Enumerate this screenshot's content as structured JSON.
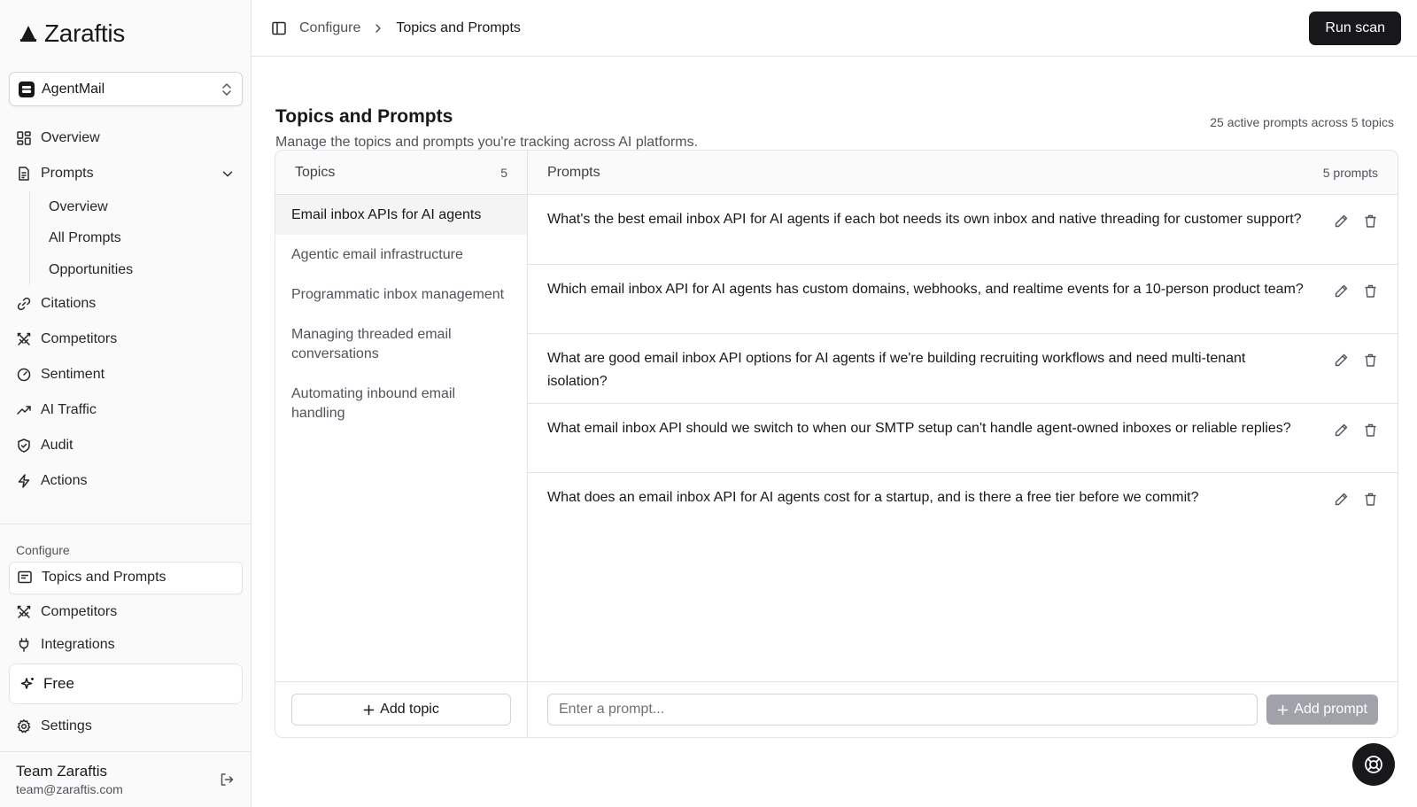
{
  "brand": {
    "name": "Zaraftis"
  },
  "workspace": {
    "name": "AgentMail"
  },
  "nav": {
    "overview": "Overview",
    "prompts": "Prompts",
    "prompts_sub": [
      "Overview",
      "All Prompts",
      "Opportunities"
    ],
    "citations": "Citations",
    "competitors": "Competitors",
    "sentiment": "Sentiment",
    "ai_traffic": "AI Traffic",
    "audit": "Audit",
    "actions": "Actions"
  },
  "configure": {
    "label": "Configure",
    "topics_prompts": "Topics and Prompts",
    "competitors": "Competitors",
    "integrations": "Integrations"
  },
  "plan": {
    "label": "Free"
  },
  "settings": {
    "label": "Settings"
  },
  "user": {
    "name": "Team Zaraftis",
    "email": "team@zaraftis.com"
  },
  "breadcrumb": {
    "parent": "Configure",
    "current": "Topics and Prompts"
  },
  "header": {
    "run_scan": "Run scan"
  },
  "page": {
    "title": "Topics and Prompts",
    "description": "Manage the topics and prompts you're tracking across AI platforms.",
    "stat": "25 active prompts across 5 topics"
  },
  "topics": {
    "header": "Topics",
    "count": "5",
    "items": [
      "Email inbox APIs for AI agents",
      "Agentic email infrastructure",
      "Programmatic inbox management",
      "Managing threaded email conversations",
      "Automating inbound email handling"
    ],
    "add_label": "Add topic"
  },
  "prompts": {
    "header": "Prompts",
    "count": "5 prompts",
    "items": [
      "What's the best email inbox API for AI agents if each bot needs its own inbox and native threading for customer support?",
      "Which email inbox API for AI agents has custom domains, webhooks, and realtime events for a 10-person product team?",
      "What are good email inbox API options for AI agents if we're building recruiting workflows and need multi-tenant isolation?",
      "What email inbox API should we switch to when our SMTP setup can't handle agent-owned inboxes or reliable replies?",
      "What does an email inbox API for AI agents cost for a startup, and is there a free tier before we commit?"
    ],
    "input_placeholder": "Enter a prompt...",
    "add_label": "Add prompt"
  }
}
